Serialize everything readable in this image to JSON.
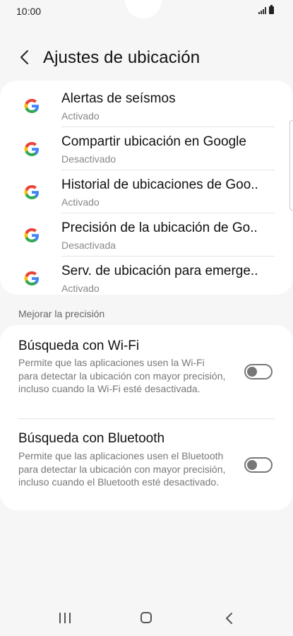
{
  "status_bar": {
    "time": "10:00",
    "icons": [
      "signal-icon",
      "battery-icon"
    ]
  },
  "header": {
    "title": "Ajustes de ubicación",
    "back_icon": "chevron-left-icon"
  },
  "google_services": [
    {
      "title": "Alertas de seísmos",
      "status": "Activado",
      "icon": "google-icon"
    },
    {
      "title": "Compartir ubicación en Google",
      "status": "Desactivado",
      "icon": "google-icon"
    },
    {
      "title": "Historial de ubicaciones de Goo..",
      "status": "Activado",
      "icon": "google-icon"
    },
    {
      "title": "Precisión de la ubicación de Go..",
      "status": "Desactivada",
      "icon": "google-icon"
    },
    {
      "title": "Serv. de ubicación para emerge..",
      "status": "Activado",
      "icon": "google-icon"
    }
  ],
  "precision": {
    "section_label": "Mejorar la precisión",
    "wifi": {
      "title": "Búsqueda con Wi-Fi",
      "description": "Permite que las aplicaciones usen la Wi-Fi para detectar la ubicación con mayor precisión, incluso cuando la Wi-Fi esté desactivada.",
      "enabled": false
    },
    "bluetooth": {
      "title": "Búsqueda con Bluetooth",
      "description": "Permite que las aplicaciones usen el Bluetooth para detectar la ubicación con mayor precisión, incluso cuando el Bluetooth esté desactivado.",
      "enabled": false
    }
  },
  "nav_bar": {
    "icons": [
      "recent-apps-icon",
      "home-icon",
      "back-icon"
    ]
  },
  "colors": {
    "background": "#f6f6f6",
    "card": "#ffffff",
    "toggle_off": "#777777",
    "secondary_text": "#888888"
  }
}
